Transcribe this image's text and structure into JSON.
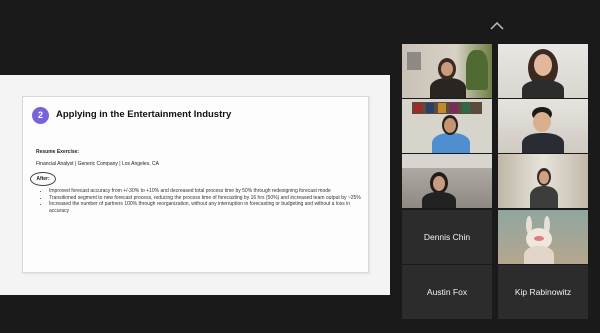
{
  "slide": {
    "step_number": "2",
    "title": "Applying in the Entertainment Industry",
    "section_label": "Resume Exercise:",
    "job_line": "Financial Analyst | Generic Company | Los Angeles, CA",
    "after_label": "After:",
    "bullets": [
      "Improved forecast accuracy from +/-30% to +10% and decreased total process time by 50% through redesigning forecast mode",
      "Transitioned segment to new forecast process, reducing the process time of forecasting by 16 hrs (50%) and increased team output by ~25%",
      "Increased the number of partners 100% through reorganization, without any interruption in forecasting or budgeting and without a loss in accuracy"
    ]
  },
  "participants": [
    {
      "name": ""
    },
    {
      "name": ""
    },
    {
      "name": ""
    },
    {
      "name": ""
    },
    {
      "name": ""
    },
    {
      "name": ""
    },
    {
      "name": "Dennis Chin"
    },
    {
      "name": ""
    },
    {
      "name": "Austin Fox"
    },
    {
      "name": "Kip Rabinowitz"
    }
  ],
  "colors": {
    "accent": "#7a63d8",
    "active_speaker": "#d7e36b",
    "background": "#1a1a1a"
  },
  "icons": {
    "collapse": "chevron-up-icon"
  }
}
